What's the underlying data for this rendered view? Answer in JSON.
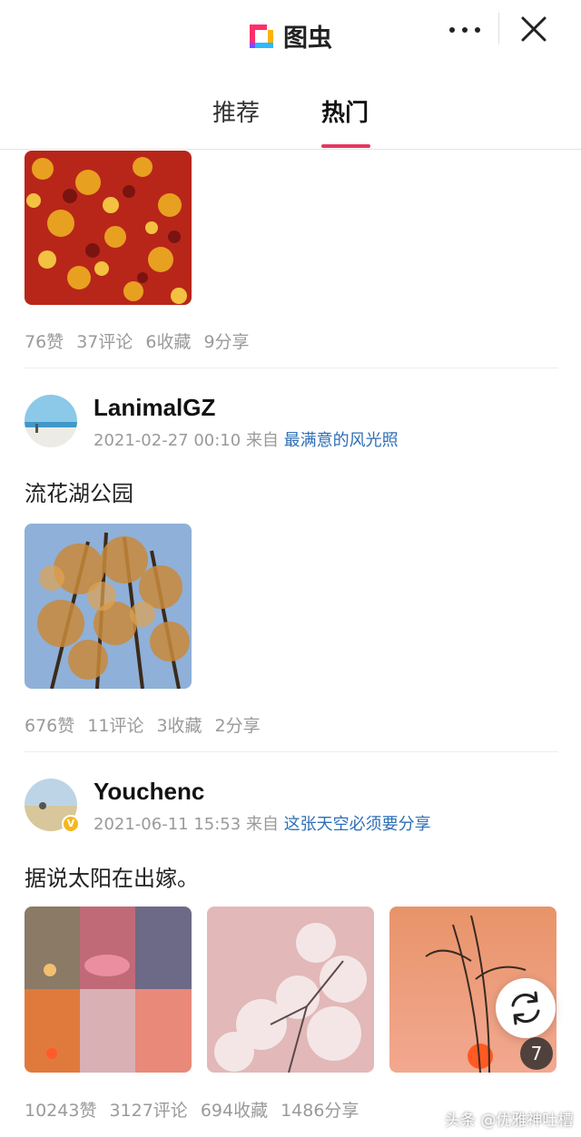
{
  "header": {
    "app_name": "图虫",
    "more_icon": "more-dots-icon",
    "close_icon": "close-icon"
  },
  "tabs": [
    {
      "label": "推荐",
      "active": false
    },
    {
      "label": "热门",
      "active": true
    }
  ],
  "colors": {
    "accent": "#e8375f",
    "link": "#2e6fb6",
    "muted": "#9a9a9a"
  },
  "posts": [
    {
      "stats": {
        "likes": "76赞",
        "comments": "37评论",
        "favorites": "6收藏",
        "shares": "9分享"
      }
    },
    {
      "username": "LanimalGZ",
      "time": "2021-02-27 00:10",
      "from_label": "来自",
      "source": "最满意的风光照",
      "text": "流花湖公园",
      "stats": {
        "likes": "676赞",
        "comments": "11评论",
        "favorites": "3收藏",
        "shares": "2分享"
      }
    },
    {
      "username": "Youchenc",
      "verified_badge": "V",
      "time": "2021-06-11 15:53",
      "from_label": "来自",
      "source": "这张天空必须要分享",
      "text": "据说太阳在出嫁。",
      "image_count": "7",
      "stats": {
        "likes": "10243赞",
        "comments": "3127评论",
        "favorites": "694收藏",
        "shares": "1486分享"
      }
    }
  ],
  "refresh_icon": "refresh-icon",
  "watermark": "头条 @优雅神吐槽"
}
